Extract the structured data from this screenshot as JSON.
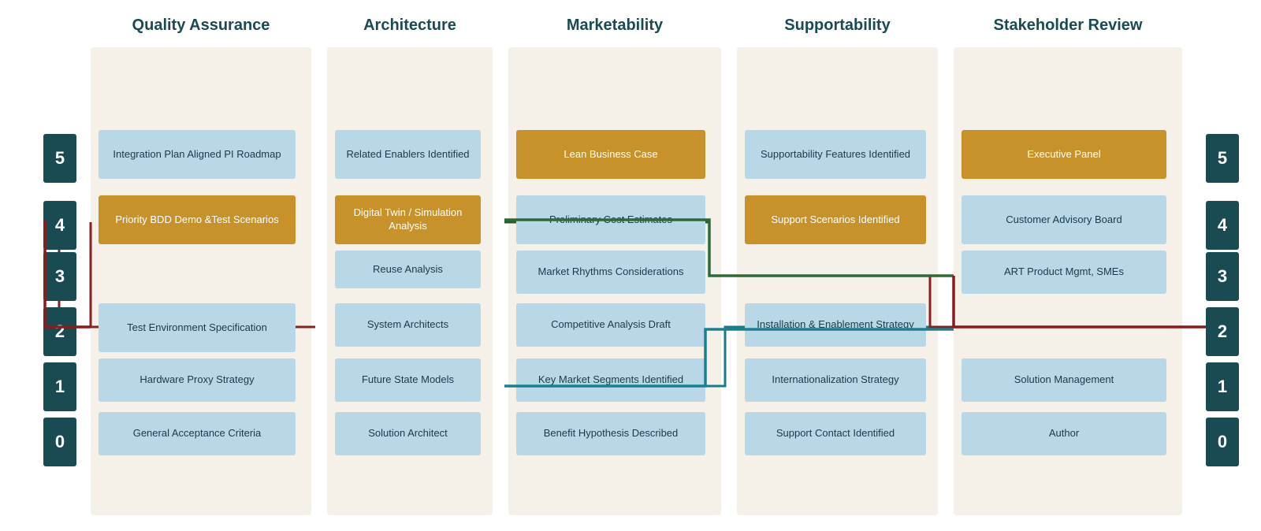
{
  "colors": {
    "dark_teal": "#1a4a52",
    "light_blue_card": "#b8d8e8",
    "orange_card": "#c8922a",
    "col_bg": "#f5f0e8",
    "white": "#ffffff",
    "dark_red_line": "#8b2020",
    "dark_green_line": "#2a5a30",
    "teal_line": "#1a7a8a"
  },
  "columns": [
    {
      "id": "qa",
      "label": "Quality\nAssurance"
    },
    {
      "id": "arch",
      "label": "Architecture"
    },
    {
      "id": "market",
      "label": "Marketability"
    },
    {
      "id": "support",
      "label": "Supportability"
    },
    {
      "id": "stake",
      "label": "Stakeholder\nReview"
    }
  ],
  "row_labels": [
    "0",
    "1",
    "2",
    "3",
    "4",
    "5"
  ],
  "cards": {
    "qa": [
      {
        "row": 5,
        "text": "Integration Plan Aligned  PI Roadmap",
        "type": "light"
      },
      {
        "row": 4,
        "text": "Priority  BDD Demo &Test Scenarios",
        "type": "orange"
      },
      {
        "row": 2,
        "text": "Test Environment Specification",
        "type": "light"
      },
      {
        "row": 1,
        "text": "Hardware Proxy Strategy",
        "type": "light"
      },
      {
        "row": 0,
        "text": "General Acceptance Criteria",
        "type": "light"
      }
    ],
    "arch": [
      {
        "row": 5,
        "text": "Related Enablers Identified",
        "type": "light"
      },
      {
        "row": 4,
        "text": "Digital Twin / Simulation Analysis",
        "type": "orange"
      },
      {
        "row": 3,
        "text": "Reuse Analysis",
        "type": "light"
      },
      {
        "row": 2,
        "text": "System Architects",
        "type": "light"
      },
      {
        "row": 1,
        "text": "Future State Models",
        "type": "light"
      },
      {
        "row": 0,
        "text": "Solution Architect",
        "type": "light"
      }
    ],
    "market": [
      {
        "row": 5,
        "text": "Lean Business Case",
        "type": "orange"
      },
      {
        "row": 4,
        "text": "Preliminary Cost Estimates",
        "type": "light"
      },
      {
        "row": 3,
        "text": "Market Rhythms Considerations",
        "type": "light"
      },
      {
        "row": 2,
        "text": "Competitive Analysis Draft",
        "type": "light"
      },
      {
        "row": 1,
        "text": "Key Market Segments Identified",
        "type": "light"
      },
      {
        "row": 0,
        "text": "Benefit Hypothesis Described",
        "type": "light"
      }
    ],
    "support": [
      {
        "row": 5,
        "text": "Supportability Features Identified",
        "type": "light"
      },
      {
        "row": 4,
        "text": "Support Scenarios Identified",
        "type": "orange"
      },
      {
        "row": 2,
        "text": "Installation & Enablement Strategy",
        "type": "light"
      },
      {
        "row": 1,
        "text": "Internationalization Strategy",
        "type": "light"
      },
      {
        "row": 0,
        "text": "Support Contact Identified",
        "type": "light"
      }
    ],
    "stake": [
      {
        "row": 5,
        "text": "Executive Panel",
        "type": "orange"
      },
      {
        "row": 4,
        "text": "Customer Advisory Board",
        "type": "light"
      },
      {
        "row": 3,
        "text": "ART Product Mgmt, SMEs",
        "type": "light"
      },
      {
        "row": 2,
        "text": "",
        "type": "none"
      },
      {
        "row": 1,
        "text": "Solution Management",
        "type": "light"
      },
      {
        "row": 0,
        "text": "Author",
        "type": "light"
      }
    ]
  }
}
